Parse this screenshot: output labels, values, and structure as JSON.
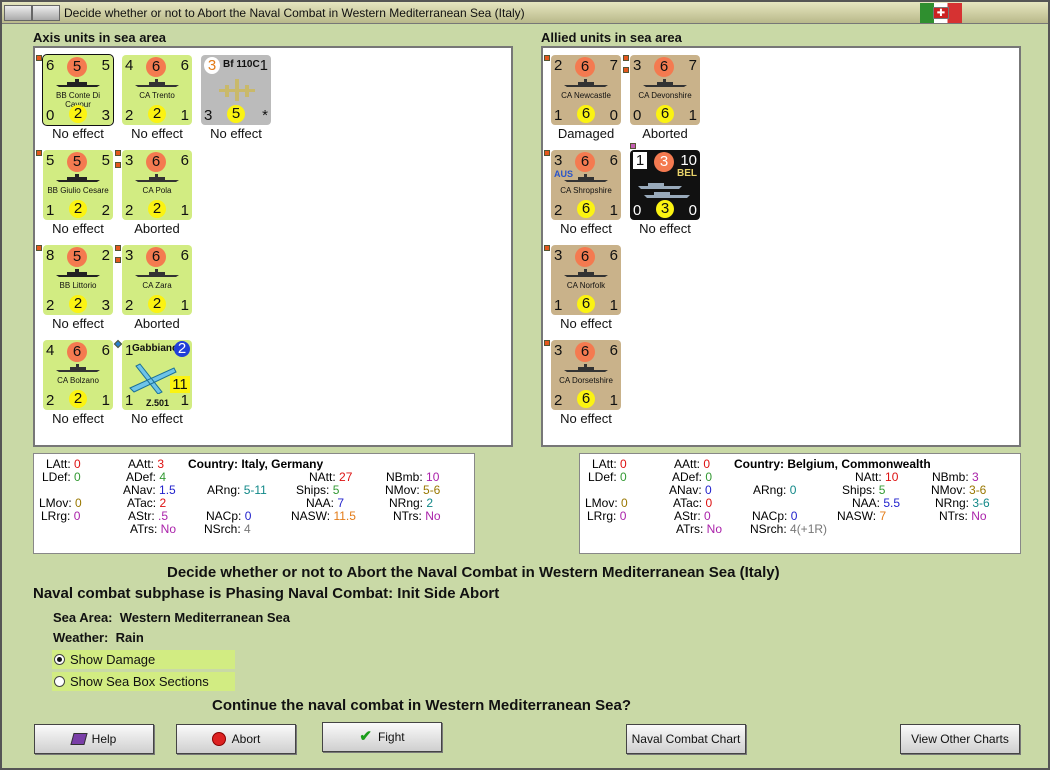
{
  "window": {
    "title": "Decide whether or not to Abort the Naval Combat in Western Mediterranean Sea (Italy)"
  },
  "axis": {
    "label": "Axis units in sea area",
    "units": [
      {
        "name": "BB Conte Di Cavour",
        "tl": "6",
        "tc": "5",
        "tr": "5",
        "bl": "0",
        "bc": "2",
        "br": "3",
        "result": "No effect"
      },
      {
        "name": "CA Trento",
        "tl": "4",
        "tc": "6",
        "tr": "6",
        "bl": "2",
        "bc": "2",
        "br": "1",
        "result": "No effect"
      },
      {
        "name": "Bf 110C",
        "tl": "3",
        "tr": "1",
        "bl": "3",
        "bc": "5",
        "br": "*",
        "result": "No effect"
      },
      {
        "name": "BB Giulio Cesare",
        "tl": "5",
        "tc": "5",
        "tr": "5",
        "bl": "1",
        "bc": "2",
        "br": "2",
        "result": "No effect"
      },
      {
        "name": "CA Pola",
        "tl": "3",
        "tc": "6",
        "tr": "6",
        "bl": "2",
        "bc": "2",
        "br": "1",
        "result": "Aborted"
      },
      {
        "name": "BB Littorio",
        "tl": "8",
        "tc": "5",
        "tr": "2",
        "bl": "2",
        "bc": "2",
        "br": "3",
        "result": "No effect"
      },
      {
        "name": "CA Zara",
        "tl": "3",
        "tc": "6",
        "tr": "6",
        "bl": "2",
        "bc": "2",
        "br": "1",
        "result": "Aborted"
      },
      {
        "name": "CA Bolzano",
        "tl": "4",
        "tc": "6",
        "tr": "6",
        "bl": "2",
        "bc": "2",
        "br": "1",
        "result": "No effect"
      },
      {
        "name": "Z.501",
        "label": "Gabbiano",
        "tl": "1",
        "tc": "2",
        "tr": "11",
        "bl": "1",
        "br": "1",
        "result": "No effect"
      }
    ]
  },
  "allied": {
    "label": "Allied units in sea area",
    "units": [
      {
        "name": "CA Newcastle",
        "tl": "2",
        "tc": "6",
        "tr": "7",
        "bl": "1",
        "bc": "6",
        "br": "0",
        "result": "Damaged"
      },
      {
        "name": "CA Devonshire",
        "tl": "3",
        "tc": "6",
        "tr": "7",
        "bl": "0",
        "bc": "6",
        "br": "1",
        "result": "Aborted"
      },
      {
        "name": "CA Shropshire",
        "flag": "AUS",
        "tl": "3",
        "tc": "6",
        "tr": "6",
        "bl": "2",
        "bc": "6",
        "br": "1",
        "result": "No effect"
      },
      {
        "name": "BEL",
        "tl": "1",
        "tc": "3",
        "tr": "10",
        "bl": "0",
        "bc": "3",
        "br": "0",
        "result": "No effect"
      },
      {
        "name": "CA Norfolk",
        "tl": "3",
        "tc": "6",
        "tr": "6",
        "bl": "1",
        "bc": "6",
        "br": "1",
        "result": "No effect"
      },
      {
        "name": "CA Dorsetshire",
        "tl": "3",
        "tc": "6",
        "tr": "6",
        "bl": "2",
        "bc": "6",
        "br": "1",
        "result": "No effect"
      }
    ]
  },
  "axis_stats": {
    "LAtt": "0",
    "LDef": "0",
    "LMov": "0",
    "LRrg": "0",
    "AAtt": "3",
    "ADef": "4",
    "ANav": "1.5",
    "ATac": "2",
    "AStr": ".5",
    "ATrs": "No",
    "ARng": "5-11",
    "country_label": "Country:",
    "country": "Italy, Germany",
    "NAtt": "27",
    "Ships": "5",
    "NAA": "7",
    "NASW": "11.5",
    "NACp": "0",
    "NSrch": "4",
    "NBmb": "10",
    "NMov": "5-6",
    "NRng": "2",
    "NTrs": "No"
  },
  "allied_stats": {
    "LAtt": "0",
    "LDef": "0",
    "LMov": "0",
    "LRrg": "0",
    "AAtt": "0",
    "ADef": "0",
    "ANav": "0",
    "ATac": "0",
    "AStr": "0",
    "ATrs": "No",
    "ARng": "0",
    "country_label": "Country:",
    "country": "Belgium, Commonwealth",
    "NAtt": "10",
    "Ships": "5",
    "NAA": "5.5",
    "NASW": "7",
    "NACp": "0",
    "NSrch": "4(+1R)",
    "NBmb": "3",
    "NMov": "3-6",
    "NRng": "3-6",
    "NTrs": "No"
  },
  "info": {
    "heading": "Decide whether or not to Abort the Naval Combat in Western Mediterranean Sea (Italy)",
    "subphase": "Naval combat subphase is Phasing Naval Combat: Init Side Abort",
    "sea_area_label": "Sea Area:",
    "sea_area": "Western Mediterranean Sea",
    "weather_label": "Weather:",
    "weather": "Rain",
    "show_damage": "Show Damage",
    "show_sea_box": "Show Sea Box Sections",
    "question": "Continue the naval combat in Western Mediterranean Sea?"
  },
  "buttons": {
    "help": "Help",
    "abort": "Abort",
    "fight": "Fight",
    "naval_chart": "Naval Combat Chart",
    "other_charts": "View Other Charts"
  },
  "colors": {
    "axis_counter": "#d2ec82",
    "allied_counter": "#c9b28a",
    "attack_circle": "#f47a50",
    "defense_circle": "#fbf312"
  }
}
